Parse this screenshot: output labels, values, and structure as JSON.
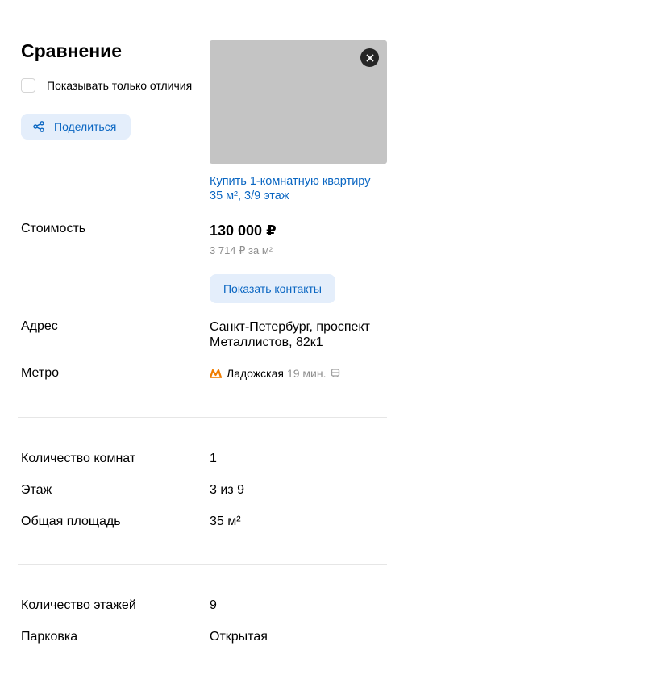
{
  "page": {
    "title": "Сравнение",
    "diff_only_label": "Показывать только отличия",
    "share_label": "Поделиться"
  },
  "listing": {
    "link_line1": "Купить 1-комнатную квартиру",
    "link_line2": "35 м², 3/9 этаж",
    "price": "130 000 ₽",
    "price_per_m2": "3 714 ₽ за м²",
    "contacts_label": "Показать контакты",
    "address_line1": "Санкт-Петербург, проспект",
    "address_line2": "Металлистов, 82к1",
    "metro_station": "Ладожская",
    "metro_time": "19 мин.",
    "metro_color": "#f07d00",
    "transport_icon": "bus-icon"
  },
  "rows": {
    "price_label": "Стоимость",
    "address_label": "Адрес",
    "metro_label": "Метро",
    "rooms_label": "Количество комнат",
    "rooms_value": "1",
    "floor_label": "Этаж",
    "floor_value": "3 из 9",
    "area_label": "Общая площадь",
    "area_value": "35 м²",
    "floors_label": "Количество этажей",
    "floors_value": "9",
    "parking_label": "Парковка",
    "parking_value": "Открытая"
  },
  "colors": {
    "accent": "#0a66c2",
    "button_bg": "#e4eefb",
    "muted": "#8f8f8f"
  }
}
